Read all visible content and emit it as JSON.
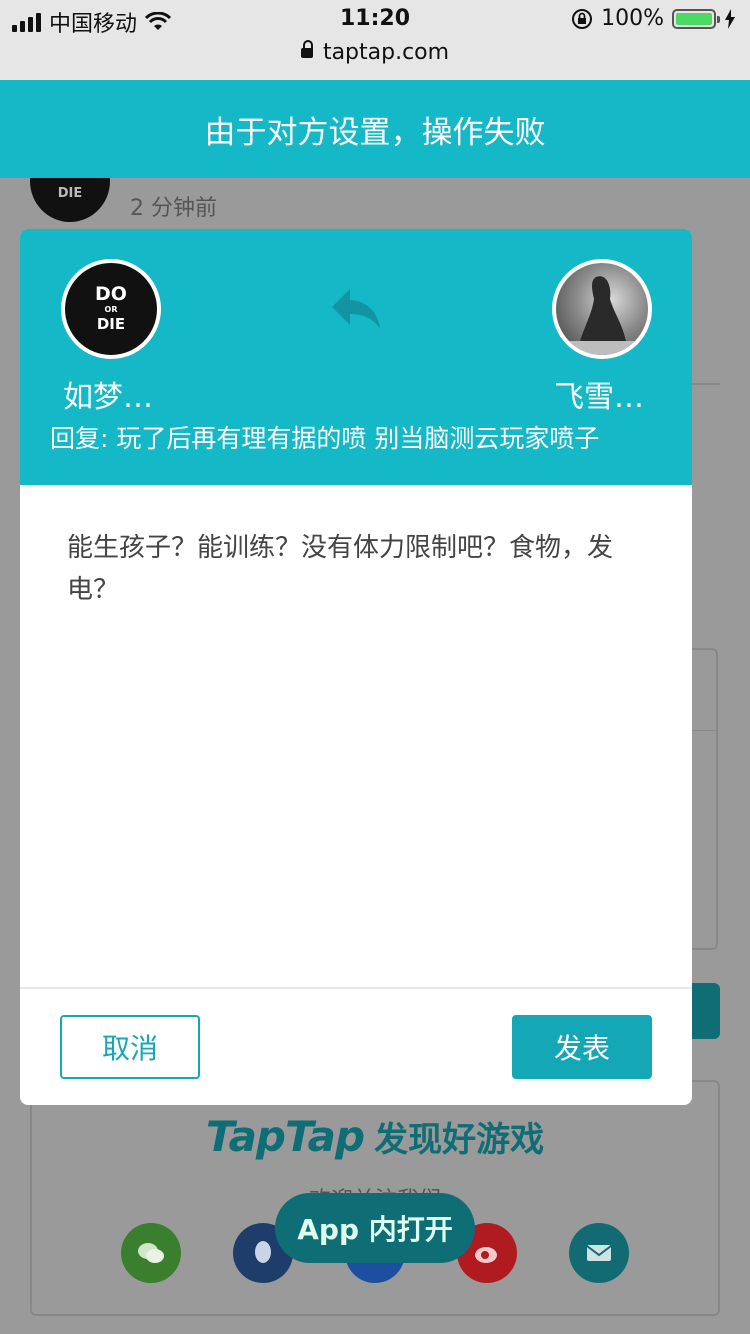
{
  "status_bar": {
    "carrier": "中国移动",
    "time": "11:20",
    "battery_percent": "100%",
    "battery_level": 1.0
  },
  "url_bar": {
    "domain": "taptap.com"
  },
  "toast": {
    "message": "由于对方设置，操作失败"
  },
  "background_page": {
    "comment_avatar_text": "DIE",
    "comment_time": "2 分钟前",
    "footer": {
      "brand_logo": "TapTap",
      "brand_slogan": "发现好游戏",
      "follow_text": "欢迎关注我们"
    },
    "social_icons": [
      "wechat-icon",
      "qq-icon",
      "zhihu-icon",
      "weibo-icon",
      "mail-icon"
    ],
    "app_open_label": "App 内打开"
  },
  "reply_dialog": {
    "from_user": {
      "name": "如梦…",
      "avatar_text_top": "DO",
      "avatar_text_mid": "OR",
      "avatar_text_bottom": "DIE"
    },
    "to_user": {
      "name": "飞雪…"
    },
    "reply_to_text": "回复: 玩了后再有理有据的喷 别当脑测云玩家喷子",
    "content": "能生孩子？能训练？没有体力限制吧？食物，发电？",
    "cancel_label": "取消",
    "submit_label": "发表"
  },
  "colors": {
    "accent": "#14b8c6",
    "button": "#14a8b6",
    "overlay_dark_teal": "#0f6d75"
  }
}
